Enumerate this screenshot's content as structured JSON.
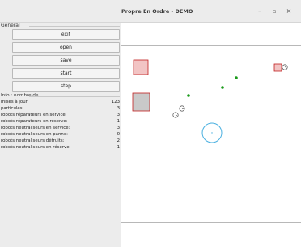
{
  "window": {
    "title": "Propre En Ordre - DEMO",
    "minimize_glyph": "–",
    "maximize_glyph": "▫",
    "close_glyph": "×"
  },
  "general": {
    "group_title": "General",
    "buttons": {
      "exit": "exit",
      "open": "open",
      "save": "save",
      "start": "start",
      "step": "step"
    }
  },
  "info": {
    "heading": "Info : nombre de ...",
    "stats": [
      {
        "label": "mises à jour:",
        "value": "123"
      },
      {
        "label": "particules:",
        "value": "3"
      },
      {
        "label": "robots réparateurs en service:",
        "value": "3"
      },
      {
        "label": "robots réparateurs en réserve:",
        "value": "1"
      },
      {
        "label": "robots neutraliseurs en service:",
        "value": "3"
      },
      {
        "label": "robots neutraliseurs en panne:",
        "value": "0"
      },
      {
        "label": "robots neutraliseurs détruits:",
        "value": "2"
      },
      {
        "label": "robots neutraliseurs en réserve:",
        "value": "1"
      }
    ]
  },
  "colors": {
    "particle_fill": "#f2c4c4",
    "particle_stroke": "#c02020",
    "repair_robot": "#1a9a1a",
    "base_circle": "#4ab0e0",
    "neutralizer": "#333333"
  }
}
